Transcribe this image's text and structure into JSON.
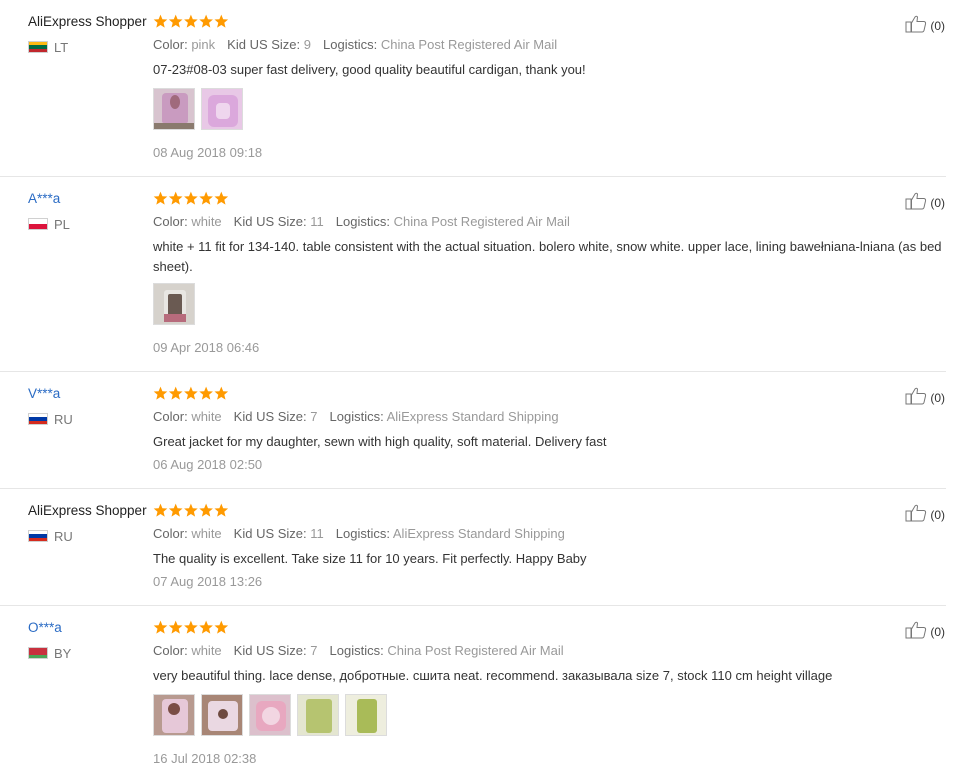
{
  "labels": {
    "color": "Color:",
    "size": "Kid US Size:",
    "logistics": "Logistics:"
  },
  "colors": {
    "star": "#ff9a00",
    "link": "#2a6bc4",
    "divider": "#e6e6e6"
  },
  "icons": {
    "rating": "star-icon",
    "helpful": "thumbs-up-icon"
  },
  "reviews": [
    {
      "author": "AliExpress Shopper",
      "country": "LT",
      "stars": 5,
      "color": "pink",
      "size": "9",
      "logistics": "China Post Registered Air Mail",
      "text": "07-23#08-03 super fast delivery, good quality beautiful cardigan, thank you!",
      "photo_count": 2,
      "date": "08 Aug 2018 09:18",
      "helpful": "(0)"
    },
    {
      "author": "A***a",
      "country": "PL",
      "stars": 5,
      "color": "white",
      "size": "11",
      "logistics": "China Post Registered Air Mail",
      "text": "white + 11 fit for 134-140. table consistent with the actual situation. bolero white, snow white. upper lace, lining bawełniana-lniana (as bed sheet).",
      "photo_count": 1,
      "date": "09 Apr 2018 06:46",
      "helpful": "(0)"
    },
    {
      "author": "V***a",
      "country": "RU",
      "stars": 5,
      "color": "white",
      "size": "7",
      "logistics": "AliExpress Standard Shipping",
      "text": "Great jacket for my daughter, sewn with high quality, soft material. Delivery fast",
      "photo_count": 0,
      "date": "06 Aug 2018 02:50",
      "helpful": "(0)"
    },
    {
      "author": "AliExpress Shopper",
      "country": "RU",
      "stars": 5,
      "color": "white",
      "size": "11",
      "logistics": "AliExpress Standard Shipping",
      "text": "The quality is excellent. Take size 11 for 10 years. Fit perfectly. Happy Baby",
      "photo_count": 0,
      "date": "07 Aug 2018 13:26",
      "helpful": "(0)"
    },
    {
      "author": "O***a",
      "country": "BY",
      "stars": 5,
      "color": "white",
      "size": "7",
      "logistics": "China Post Registered Air Mail",
      "text": "very beautiful thing. lace dense, добротные. сшита neat. recommend. заказывала size 7, stock 110 cm height village",
      "photo_count": 5,
      "date": "16 Jul 2018 02:38",
      "helpful": "(0)"
    }
  ]
}
